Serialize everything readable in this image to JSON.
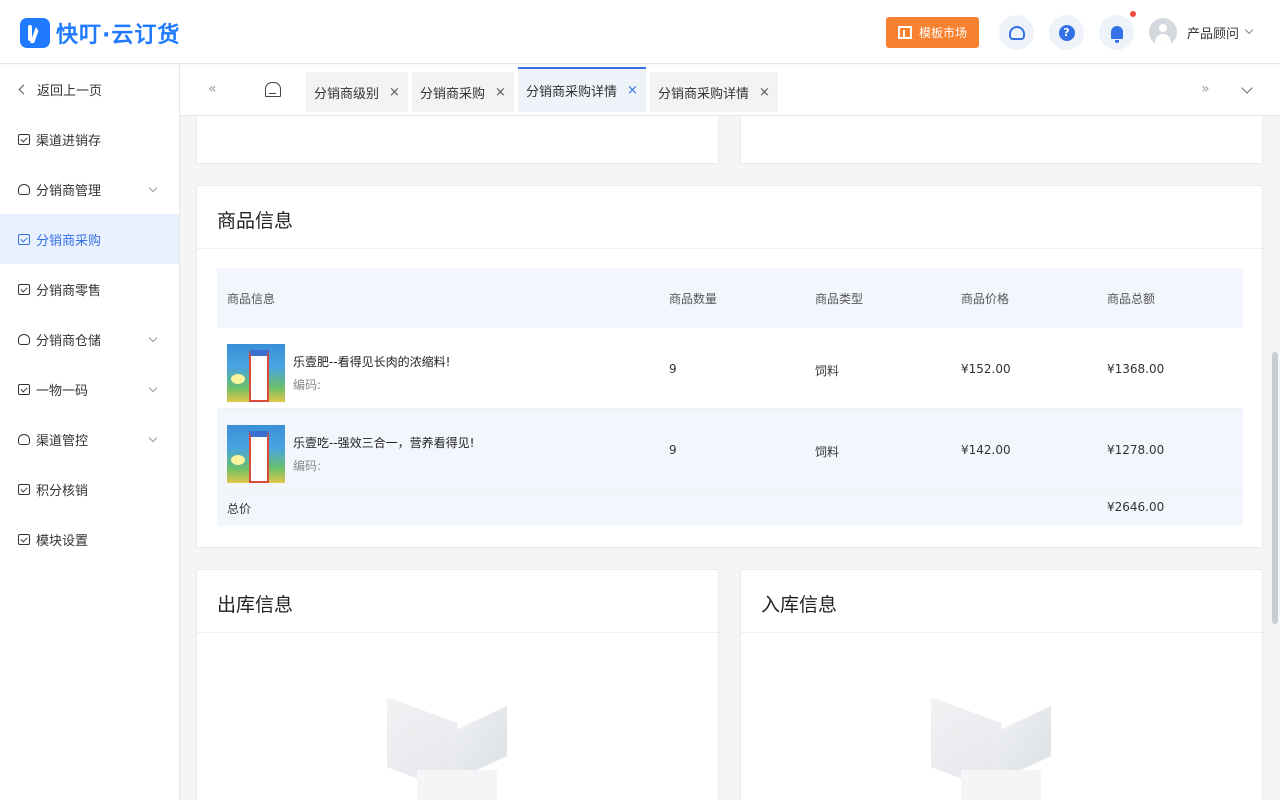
{
  "app": {
    "logo_text": "快叮·云订货"
  },
  "header": {
    "market_label": "模板市场",
    "user_name": "产品顾问",
    "icons": [
      "service-icon",
      "help-icon",
      "bell-icon",
      "avatar"
    ],
    "help_glyph": "?"
  },
  "sidebar": {
    "back_label": "返回上一页",
    "items": [
      {
        "label": "渠道进销存"
      },
      {
        "label": "分销商管理"
      },
      {
        "label": "分销商采购"
      },
      {
        "label": "分销商零售"
      },
      {
        "label": "分销商仓储"
      },
      {
        "label": "一物一码"
      },
      {
        "label": "渠道管控"
      },
      {
        "label": "积分核销"
      },
      {
        "label": "模块设置"
      }
    ],
    "active_item": "分销商采购"
  },
  "tabs": {
    "prev_glyph": "«",
    "next_glyph": "»",
    "items": [
      {
        "label": "分销商级别",
        "close": "×"
      },
      {
        "label": "分销商采购",
        "close": "×"
      },
      {
        "label": "分销商采购详情",
        "close": "×"
      },
      {
        "label": "分销商采购详情",
        "close": "×"
      }
    ],
    "active_index": 2
  },
  "goods": {
    "title": "商品信息",
    "headers": [
      "商品信息",
      "商品数量",
      "商品类型",
      "商品价格",
      "商品总额"
    ],
    "rows": [
      {
        "name": "乐壹肥--看得见长肉的浓缩料!",
        "code_label": "编码:",
        "qty": "9",
        "type": "饲料",
        "price": "¥152.00",
        "total": "¥1368.00"
      },
      {
        "name": "乐壹吃--强效三合一，营养看得见!",
        "code_label": "编码:",
        "qty": "9",
        "type": "饲料",
        "price": "¥142.00",
        "total": "¥1278.00"
      }
    ],
    "total_label": "总价",
    "total_value": "¥2646.00"
  },
  "outbound": {
    "title": "出库信息"
  },
  "inbound": {
    "title": "入库信息"
  },
  "colors": {
    "primary": "#3471e6",
    "brand": "#1f7aff",
    "market": "#f7812f"
  }
}
